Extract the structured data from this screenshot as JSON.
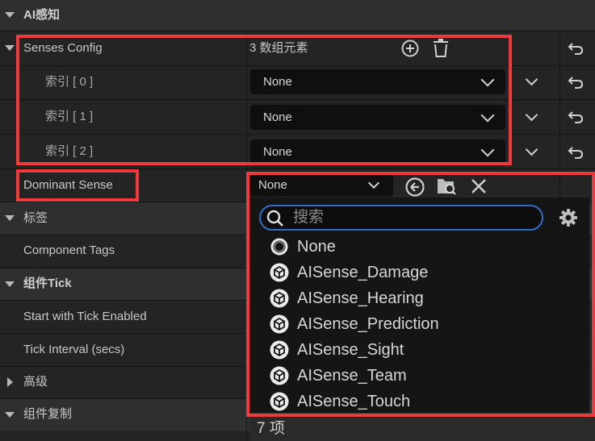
{
  "categories": {
    "ai_perception": "AI感知",
    "tags": "标签",
    "component_tick": "组件Tick",
    "advanced": "高级",
    "component_replication": "组件复制"
  },
  "senses_config": {
    "label": "Senses Config",
    "count_text": "3 数组元素",
    "elements": [
      {
        "label": "索引 [ 0 ]",
        "value": "None"
      },
      {
        "label": "索引 [ 1 ]",
        "value": "None"
      },
      {
        "label": "索引 [ 2 ]",
        "value": "None"
      }
    ]
  },
  "dominant_sense": {
    "label": "Dominant Sense",
    "value": "None"
  },
  "properties": {
    "component_tags": "Component Tags",
    "start_with_tick": "Start with Tick Enabled",
    "tick_interval": "Tick Interval (secs)"
  },
  "class_picker": {
    "search_placeholder": "搜索",
    "items": [
      {
        "label": "None",
        "icon": "none-circle-icon"
      },
      {
        "label": "AISense_Damage",
        "icon": "class-cube-icon"
      },
      {
        "label": "AISense_Hearing",
        "icon": "class-cube-icon"
      },
      {
        "label": "AISense_Prediction",
        "icon": "class-cube-icon"
      },
      {
        "label": "AISense_Sight",
        "icon": "class-cube-icon"
      },
      {
        "label": "AISense_Team",
        "icon": "class-cube-icon"
      },
      {
        "label": "AISense_Touch",
        "icon": "class-cube-icon"
      }
    ],
    "footer_count": "7 项"
  },
  "colors": {
    "highlight_box": "#ee3a3a",
    "search_focus": "#2e6ec9"
  }
}
